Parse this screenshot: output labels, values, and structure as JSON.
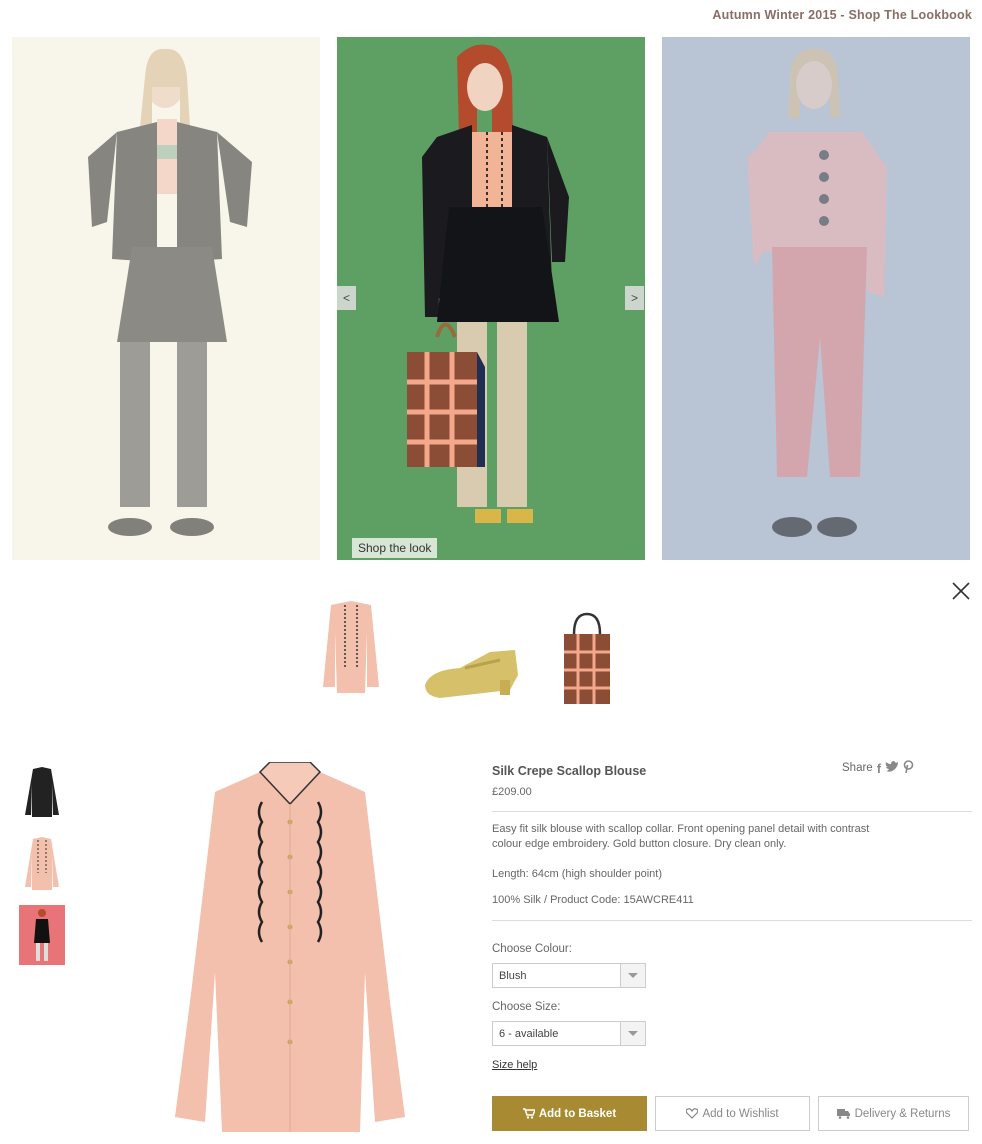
{
  "header": {
    "lookbook_title": "Autumn Winter 2015 - Shop The Lookbook"
  },
  "carousel": {
    "prev_label": "<",
    "next_label": ">",
    "shop_the_look_label": "Shop the look",
    "colors": {
      "panel_left": "#f8f5ea",
      "panel_center": "#5e9f64",
      "panel_right": "#b9c4d5"
    }
  },
  "look_items": [
    "blouse-thumbnail",
    "shoe-thumbnail",
    "bag-thumbnail"
  ],
  "product": {
    "title": "Silk Crepe Scallop Blouse",
    "price": "£209.00",
    "share_label": "Share",
    "share_icons": [
      "facebook-icon",
      "twitter-icon",
      "pinterest-icon"
    ],
    "description": "Easy fit silk blouse with scallop collar. Front opening panel detail with contrast colour edge embroidery. Gold button closure. Dry clean only.",
    "length": "Length: 64cm (high shoulder point)",
    "material_code": "100% Silk / Product Code: 15AWCRE411",
    "colour_label": "Choose Colour:",
    "colour_value": "Blush",
    "size_label": "Choose Size:",
    "size_value": "6 - available",
    "size_help": "Size help",
    "add_to_basket": "Add to Basket",
    "add_to_wishlist": "Add to Wishlist",
    "delivery_returns": "Delivery & Returns",
    "colors": {
      "accent": "#a78a31",
      "blouse": "#f2c0ad"
    }
  }
}
